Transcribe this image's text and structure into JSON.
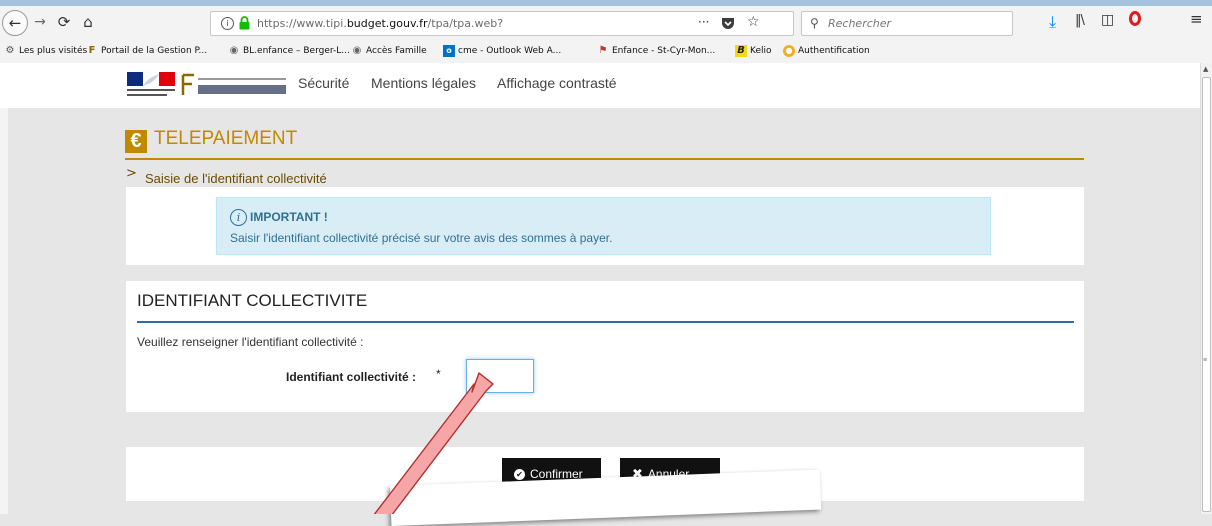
{
  "browser": {
    "url": {
      "prefix": "https://www.tipi.",
      "domain": "budget.gouv.fr",
      "path": "/tpa/tpa.web?"
    },
    "search_placeholder": "Rechercher",
    "page_actions": "···",
    "bookmarks": [
      {
        "icon": "gear-icon",
        "label": "Les plus visités"
      },
      {
        "icon": "finances-icon",
        "label": "Portail de la Gestion P..."
      },
      {
        "icon": "globe-icon",
        "label": "BL.enfance – Berger-L..."
      },
      {
        "icon": "globe-icon",
        "label": "Accès Famille"
      },
      {
        "icon": "outlook-icon",
        "label": "cme - Outlook Web A..."
      },
      {
        "icon": "flag-icon",
        "label": "Enfance - St-Cyr-Mon..."
      },
      {
        "icon": "kelio-icon",
        "label": "Kelio"
      },
      {
        "icon": "auth-icon",
        "label": "Authentification"
      }
    ]
  },
  "site_header": {
    "links": [
      "Sécurité",
      "Mentions légales",
      "Affichage contrasté"
    ]
  },
  "telepaiement": {
    "title": "TELEPAIEMENT",
    "step": "Saisie de l'identifiant collectivité"
  },
  "important": {
    "title": "IMPORTANT !",
    "text": "Saisir l'identifiant collectivité précisé sur votre avis des sommes à payer."
  },
  "identifiant": {
    "title": "IDENTIFIANT COLLECTIVITE",
    "instruction": "Veuillez renseigner l'identifiant collectivité :",
    "label": "Identifiant collectivité :",
    "required_mark": "*",
    "value": ""
  },
  "actions": {
    "confirm": "Confirmer",
    "cancel": "Annuler"
  },
  "colors": {
    "accent_gold": "#c08a00",
    "info_blue": "#31708f",
    "rule_blue": "#2e6da4",
    "arrow_fill": "#f6a6a6"
  }
}
